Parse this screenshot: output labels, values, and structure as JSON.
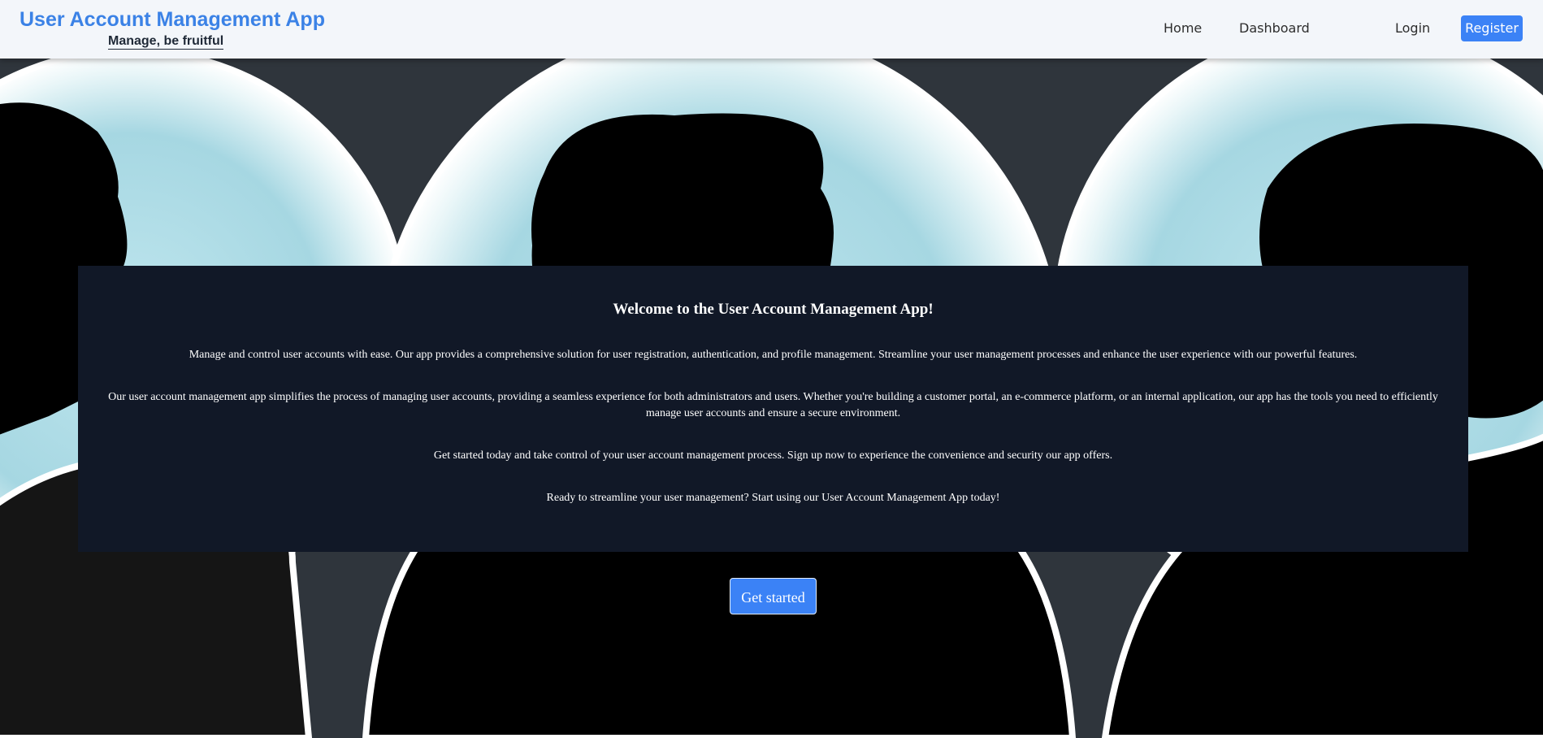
{
  "header": {
    "brand_title": "User Account Management App",
    "brand_tagline": "Manage, be fruitful",
    "nav": {
      "home": "Home",
      "dashboard": "Dashboard",
      "login": "Login",
      "register": "Register"
    },
    "accent_color": "#3b82f6"
  },
  "hero": {
    "heading": "Welcome to the User Account Management App!",
    "paragraphs": [
      "Manage and control user accounts with ease. Our app provides a comprehensive solution for user registration, authentication, and profile management. Streamline your user management processes and enhance the user experience with our powerful features.",
      "Our user account management app simplifies the process of managing user accounts, providing a seamless experience for both administrators and users. Whether you're building a customer portal, an e-commerce platform, or an internal application, our app has the tools you need to efficiently manage user accounts and ensure a secure environment.",
      "Get started today and take control of your user account management process. Sign up now to experience the convenience and security our app offers.",
      "Ready to streamline your user management? Start using our User Account Management App today!"
    ],
    "cta_label": "Get started",
    "panel_color": "#111827"
  }
}
